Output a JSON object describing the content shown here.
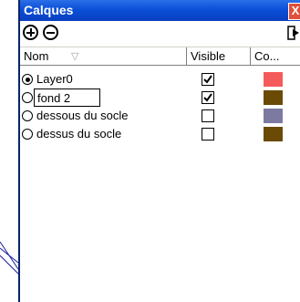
{
  "window": {
    "title": "Calques",
    "close_label": "X"
  },
  "toolbar": {
    "add_icon": "plus-circle-icon",
    "remove_icon": "minus-circle-icon",
    "export_icon": "export-arrow-icon"
  },
  "header": {
    "name": "Nom",
    "visible": "Visible",
    "color": "Co..."
  },
  "edit": {
    "value": "fond 2"
  },
  "layers": [
    {
      "name": "Layer0",
      "active": true,
      "visible": true,
      "color": "#f55a5a"
    },
    {
      "name": "fond 2",
      "active": false,
      "visible": true,
      "color": "#6b4a05",
      "editing": true
    },
    {
      "name": "dessous du socle",
      "active": false,
      "visible": false,
      "color": "#7c7aa0"
    },
    {
      "name": "dessus du socle",
      "active": false,
      "visible": false,
      "color": "#6b4a05"
    }
  ]
}
